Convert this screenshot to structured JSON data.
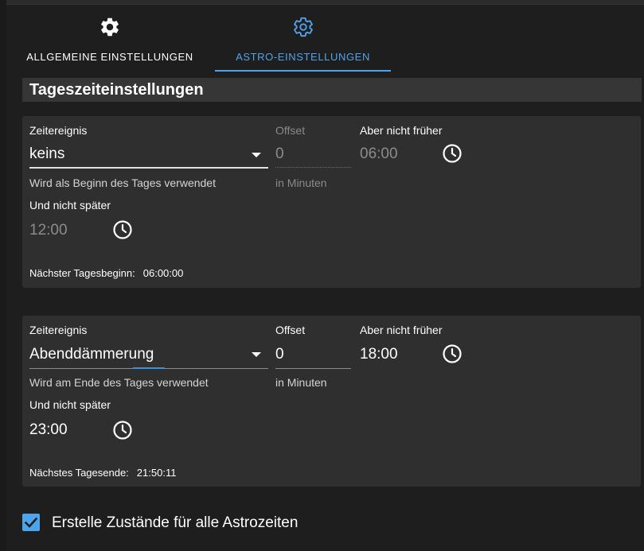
{
  "tabs": [
    {
      "label": "Allgemeine Einstellungen",
      "icon": "gear-icon",
      "active": false
    },
    {
      "label": "Astro-Einstellungen",
      "icon": "gear-icon",
      "active": true
    }
  ],
  "section_title": "Tageszeiteinstellungen",
  "day_start": {
    "event_label": "Zeitereignis",
    "event_value": "keins",
    "event_hint": "Wird als Beginn des Tages verwendet",
    "offset_label": "Offset",
    "offset_value": "0",
    "offset_hint": "in Minuten",
    "not_before_label": "Aber nicht früher",
    "not_before_value": "06:00",
    "not_after_label": "Und nicht später",
    "not_after_value": "12:00",
    "next_label": "Nächster Tagesbeginn:",
    "next_value": "06:00:00"
  },
  "day_end": {
    "event_label": "Zeitereignis",
    "event_value": "Abenddämmerung",
    "event_hint": "Wird am Ende des Tages verwendet",
    "offset_label": "Offset",
    "offset_value": "0",
    "offset_hint": "in Minuten",
    "not_before_label": "Aber nicht früher",
    "not_before_value": "18:00",
    "not_after_label": "Und nicht später",
    "not_after_value": "23:00",
    "next_label": "Nächstes Tagesende:",
    "next_value": "21:50:11"
  },
  "astro_states": {
    "label": "Erstelle Zustände für alle Astrozeiten",
    "checked": true
  },
  "colors": {
    "accent": "#4ea4ec",
    "background": "#1e1e1e",
    "card": "#2f2f2f"
  }
}
